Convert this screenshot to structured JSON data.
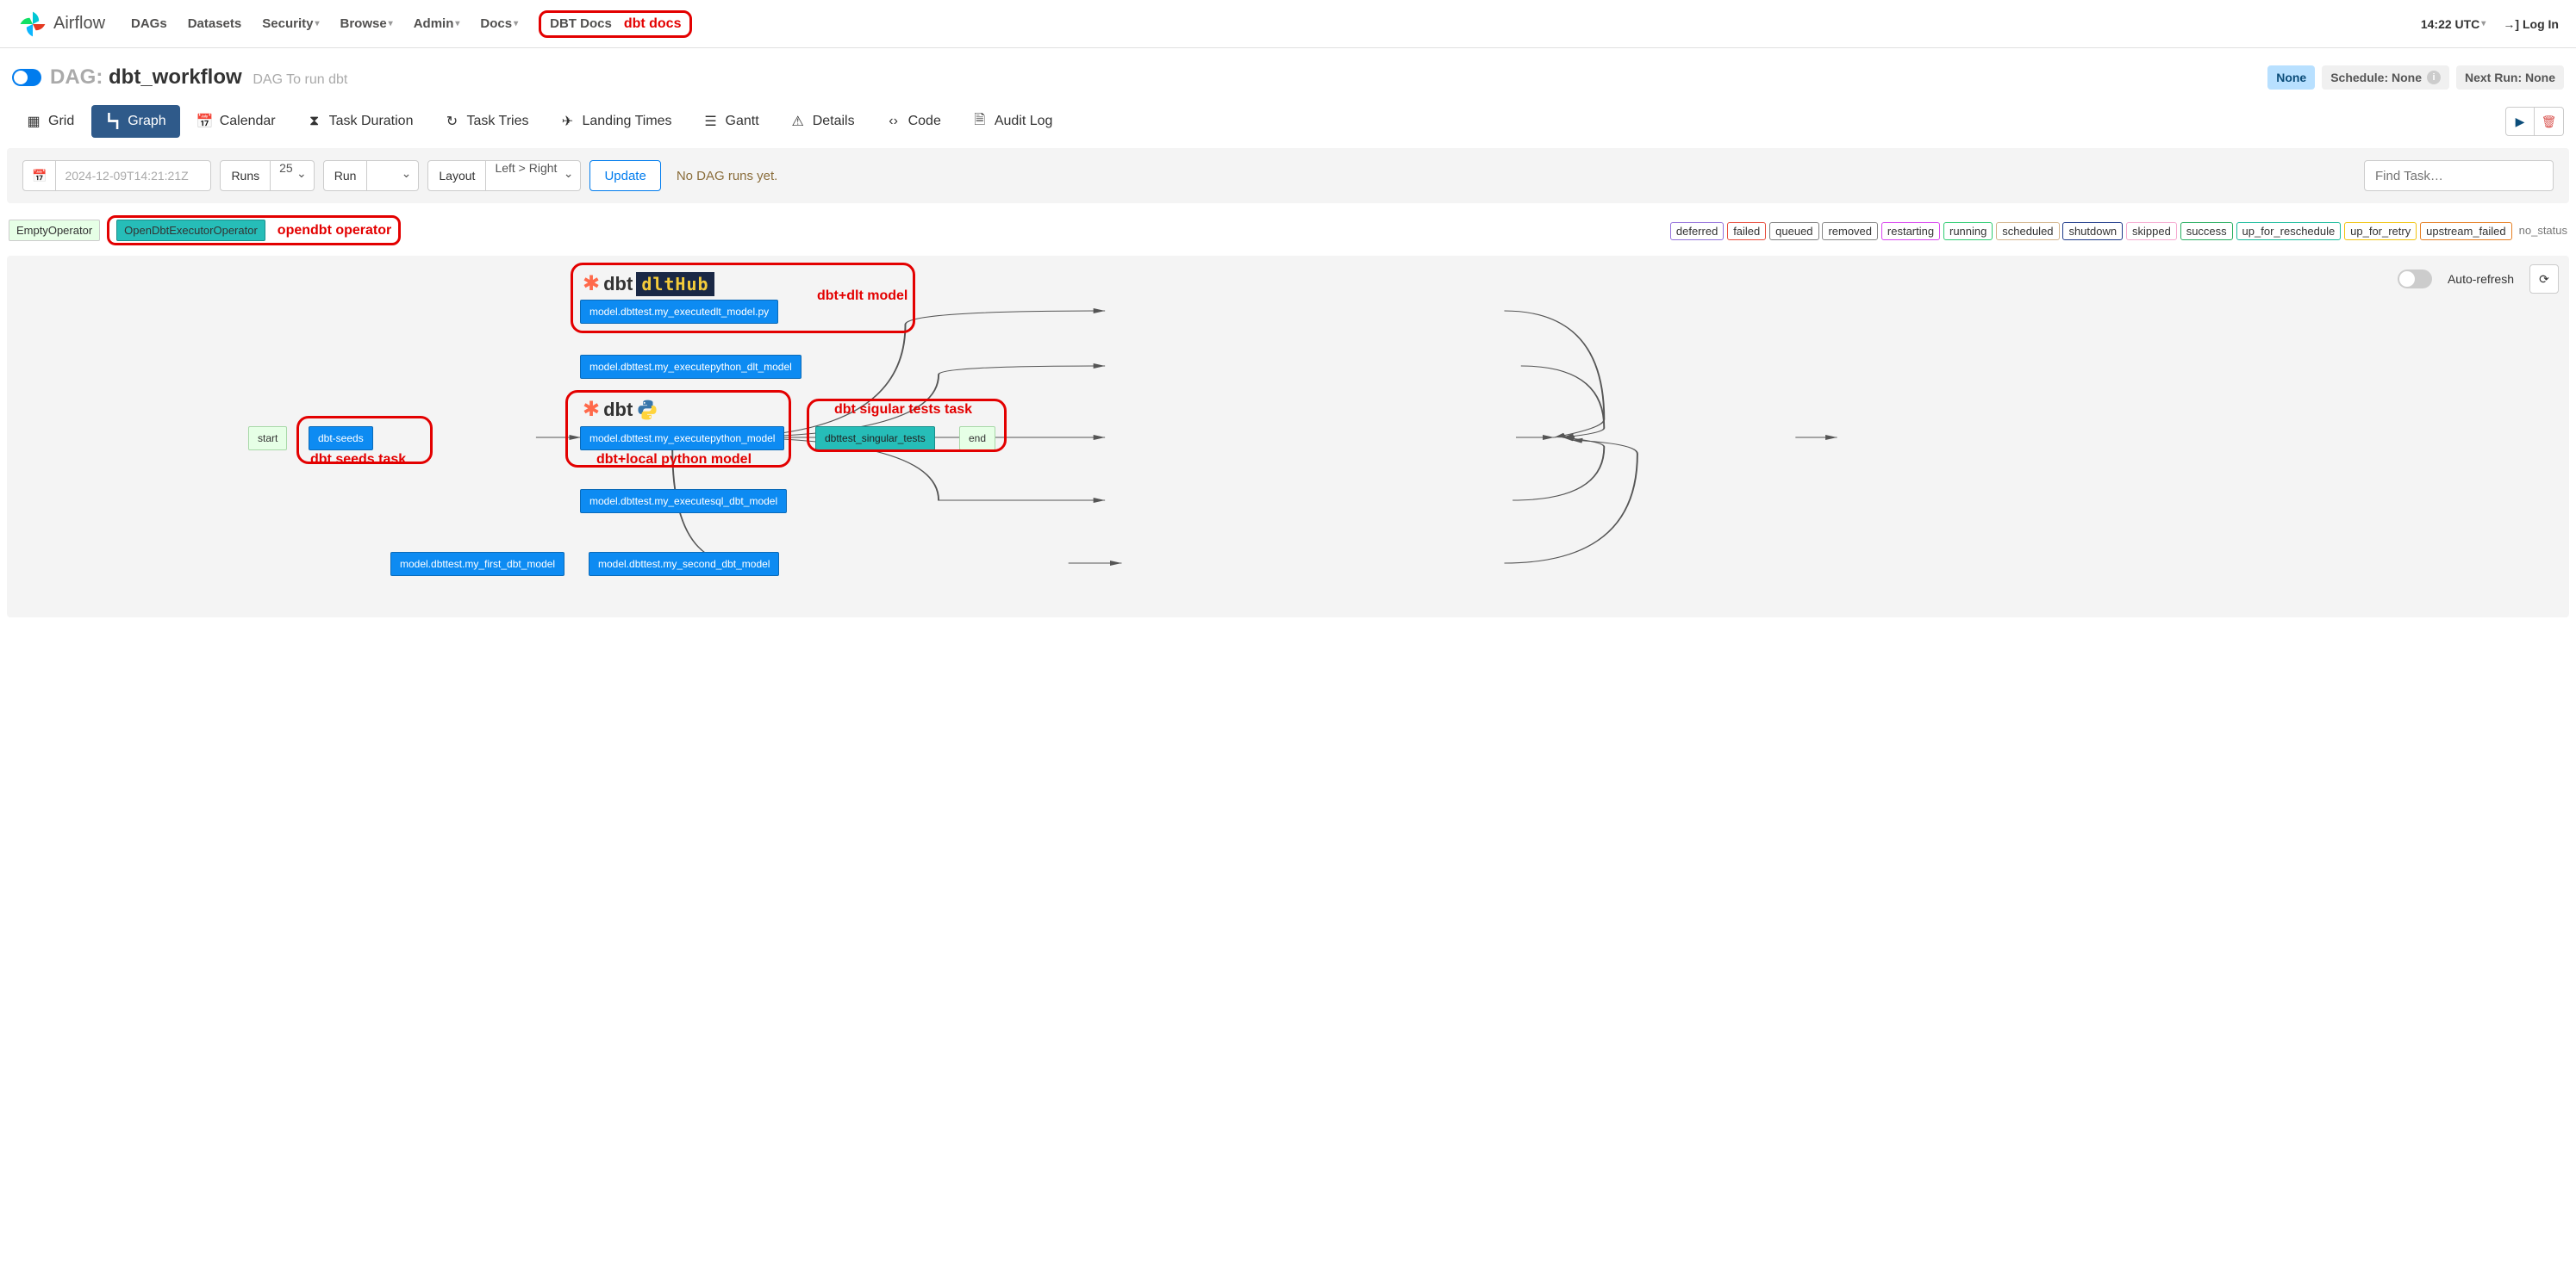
{
  "navbar": {
    "brand": "Airflow",
    "links": [
      "DAGs",
      "Datasets",
      "Security",
      "Browse",
      "Admin",
      "Docs",
      "DBT Docs"
    ],
    "dropdown_flags": [
      false,
      false,
      true,
      true,
      true,
      true,
      false
    ],
    "dbt_docs_annotation": "dbt docs",
    "time": "14:22 UTC",
    "login": "Log In"
  },
  "header": {
    "prefix": "DAG:",
    "name": "dbt_workflow",
    "description": "DAG To run dbt",
    "pill_none": "None",
    "pill_schedule": "Schedule: None",
    "pill_next": "Next Run: None"
  },
  "tabs": [
    "Grid",
    "Graph",
    "Calendar",
    "Task Duration",
    "Task Tries",
    "Landing Times",
    "Gantt",
    "Details",
    "Code",
    "Audit Log"
  ],
  "active_tab": "Graph",
  "controls": {
    "date_placeholder": "2024-12-09T14:21:21Z",
    "runs_label": "Runs",
    "runs_value": "25",
    "run_label": "Run",
    "run_value": "",
    "layout_label": "Layout",
    "layout_value": "Left > Right",
    "update": "Update",
    "no_runs_msg": "No DAG runs yet.",
    "find_placeholder": "Find Task…"
  },
  "operators": {
    "empty": "EmptyOperator",
    "opendbt": "OpenDbtExecutorOperator",
    "opendbt_annotation": "opendbt operator"
  },
  "states": [
    {
      "label": "deferred",
      "color": "#9370db"
    },
    {
      "label": "failed",
      "color": "#e74c3c"
    },
    {
      "label": "queued",
      "color": "#808080"
    },
    {
      "label": "removed",
      "color": "#888"
    },
    {
      "label": "restarting",
      "color": "#d946ef"
    },
    {
      "label": "running",
      "color": "#2ecc71"
    },
    {
      "label": "scheduled",
      "color": "#d2b48c"
    },
    {
      "label": "shutdown",
      "color": "#1e3a8a"
    },
    {
      "label": "skipped",
      "color": "#f5a9d0"
    },
    {
      "label": "success",
      "color": "#27ae60"
    },
    {
      "label": "up_for_reschedule",
      "color": "#1abc9c"
    },
    {
      "label": "up_for_retry",
      "color": "#f1c40f"
    },
    {
      "label": "upstream_failed",
      "color": "#e67e22"
    }
  ],
  "no_status_label": "no_status",
  "graph": {
    "nodes": {
      "start": "start",
      "seeds": "dbt-seeds",
      "dlt_py": "model.dbttest.my_executedlt_model.py",
      "py_dlt": "model.dbttest.my_executepython_dlt_model",
      "py": "model.dbttest.my_executepython_model",
      "sql_dbt": "model.dbttest.my_executesql_dbt_model",
      "first": "model.dbttest.my_first_dbt_model",
      "second": "model.dbttest.my_second_dbt_model",
      "tests": "dbttest_singular_tests",
      "end": "end"
    },
    "auto_refresh_label": "Auto-refresh",
    "annotations": {
      "dlt_model": "dbt+dlt model",
      "seeds_task": "dbt seeds task",
      "python_model": "dbt+local python model",
      "tests_task": "dbt sigular tests task",
      "dbt_text": "dbt",
      "dlthub_text": "dltHub"
    }
  }
}
